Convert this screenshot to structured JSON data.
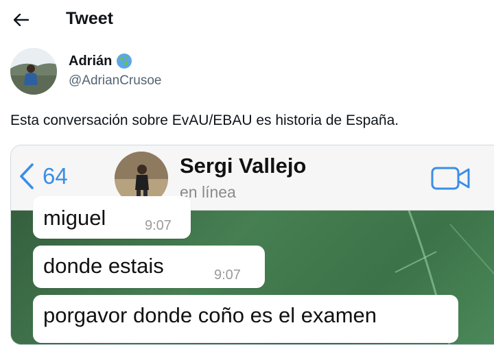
{
  "header": {
    "title": "Tweet"
  },
  "author": {
    "name": "Adrián",
    "handle": "@AdrianCrusoe"
  },
  "tweet": {
    "text": "Esta conversación sobre EvAU/EBAU es historia de España."
  },
  "chat": {
    "back_count": "64",
    "contact_name": "Sergi Vallejo",
    "contact_status": "en línea",
    "messages": [
      {
        "text": "miguel",
        "time": "9:07"
      },
      {
        "text": "donde estais",
        "time": "9:07"
      },
      {
        "text": "porgavor donde coño es el examen",
        "time": ""
      }
    ]
  },
  "colors": {
    "accent_blue": "#3a8ee6",
    "chat_green": "#3f7a4d",
    "text": "#0f1419",
    "muted": "#536471"
  }
}
